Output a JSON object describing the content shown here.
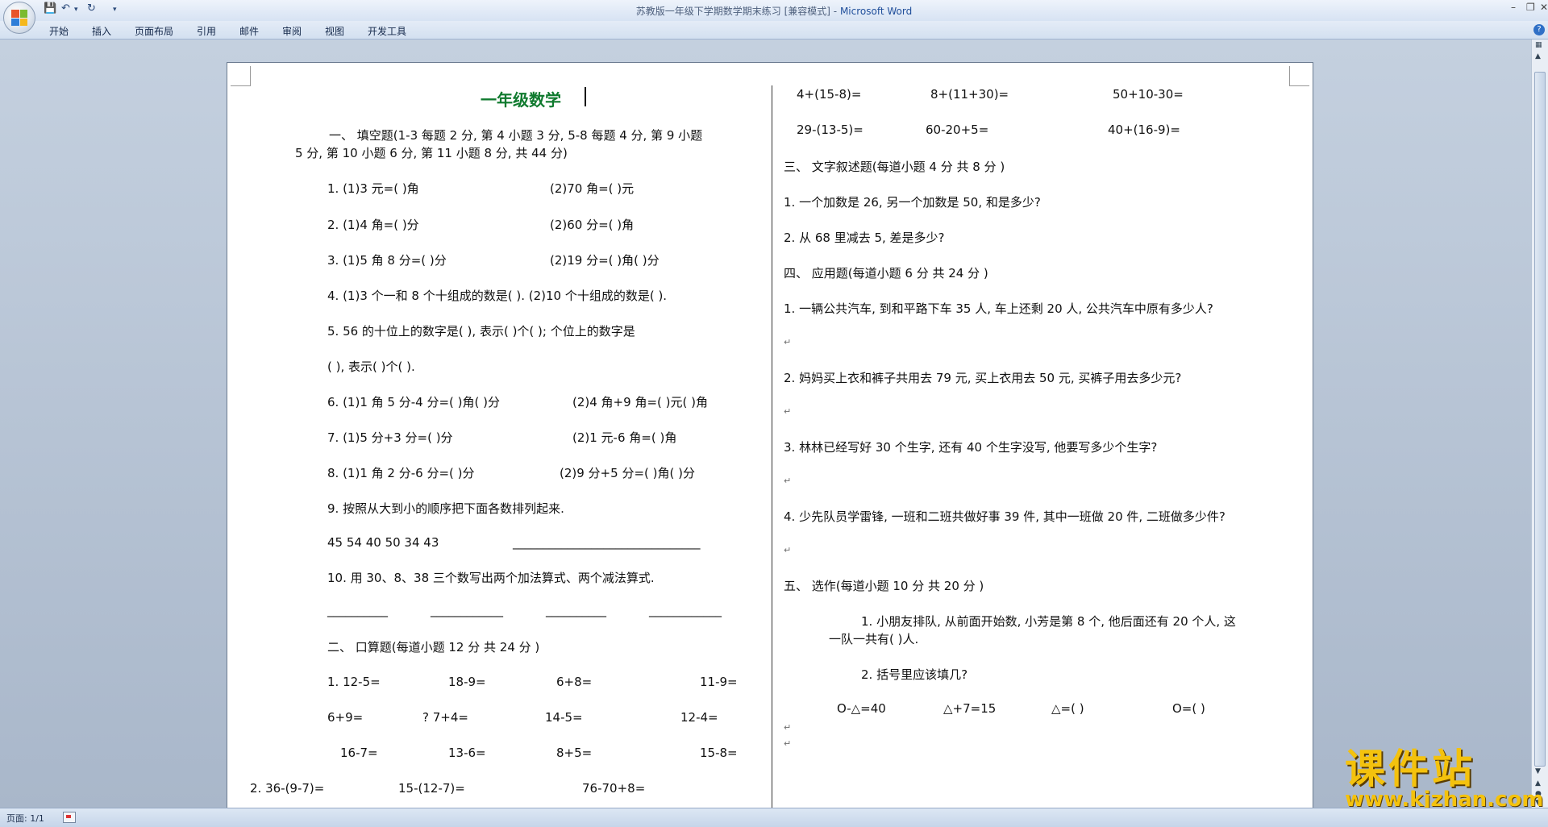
{
  "window": {
    "title_doc": "苏教版一年级下学期数学期末练习 [兼容模式] -",
    "title_app": "Microsoft Word"
  },
  "quick_access": {
    "save_icon": "save-icon",
    "undo_icon": "undo-icon",
    "redo_icon": "redo-icon"
  },
  "ribbon": {
    "tabs": [
      "开始",
      "插入",
      "页面布局",
      "引用",
      "邮件",
      "审阅",
      "视图",
      "开发工具"
    ]
  },
  "doc": {
    "title": "一年级数学",
    "left": [
      "一、 填空题(1-3 每题 2 分, 第 4 小题 3 分, 5-8 每题 4 分, 第 9 小题",
      "5 分, 第 10 小题 6 分, 第 11 小题 8 分, 共 44 分)",
      "1.    (1)3 元=(     )角",
      "(2)70 角=(     )元",
      "2.    (1)4 角=(     )分",
      "(2)60 分=(     )角",
      "3.    (1)5 角 8 分=(     )分",
      "(2)19 分=(     )角(     )分",
      "4.    (1)3 个一和 8 个十组成的数是(   ).  (2)10 个十组成的数是( ).",
      "5. 56 的十位上的数字是(      ), 表示(      )个(      ); 个位上的数字是",
      "(    ), 表示(     )个(      ).",
      "6.    (1)1 角 5 分-4 分=(   )角(   )分",
      "(2)4 角+9 角=(   )元(     )角",
      "7.    (1)5 分+3 分=(     )分",
      "(2)1 元-6 角=(     )角",
      "8.    (1)1 角 2 分-6 分=(     )分",
      "(2)9 分+5 分=(     )角(     )分",
      "9. 按照从大到小的顺序把下面各数排列起来.",
      "45    54    40    50    34    43",
      "_______________________________",
      "10. 用 30、8、38 三个数写出两个加法算式、两个减法算式.",
      "__________",
      "____________",
      "__________",
      "____________",
      "二、  口算题(每道小题 12 分  共 24 分 )",
      "1. 12-5=",
      "18-9=",
      "6+8=",
      "11-9=",
      "6+9=",
      "? 7+4=",
      "14-5=",
      "12-4=",
      "16-7=",
      "13-6=",
      "8+5=",
      "15-8=",
      "2. 36-(9-7)=",
      "15-(12-7)=",
      "76-70+8="
    ],
    "right": [
      "4+(15-8)=",
      "8+(11+30)=",
      "50+10-30=",
      "29-(13-5)=",
      "60-20+5=",
      "40+(16-9)=",
      "三、  文字叙述题(每道小题 4 分  共  8 分 )",
      "1. 一个加数是 26,   另一个加数是 50,   和是多少?",
      "2. 从 68 里减去 5,   差是多少?",
      "四、  应用题(每道小题 6 分  共 24 分 )",
      "1. 一辆公共汽车, 到和平路下车 35 人, 车上还剩 20 人, 公共汽车中原有多少人?",
      "2. 妈妈买上衣和裤子共用去 79 元, 买上衣用去 50 元, 买裤子用去多少元?",
      "3. 林林已经写好 30 个生字, 还有 40 个生字没写, 他要写多少个生字?",
      "4. 少先队员学雷锋, 一班和二班共做好事 39 件, 其中一班做 20 件, 二班做多少件?",
      "五、  选作(每道小题 10 分  共  20 分 )",
      "1. 小朋友排队, 从前面开始数, 小芳是第 8 个, 他后面还有 20 个人, 这",
      "一队一共有(      )人.",
      "2. 括号里应该填几?",
      "O-△=40",
      "△+7=15",
      "△=(      )",
      "O=(      )"
    ]
  },
  "status": {
    "page": "页面: 1/1"
  },
  "watermark": {
    "cn": "课件站",
    "url": "www.kjzhan.com"
  }
}
